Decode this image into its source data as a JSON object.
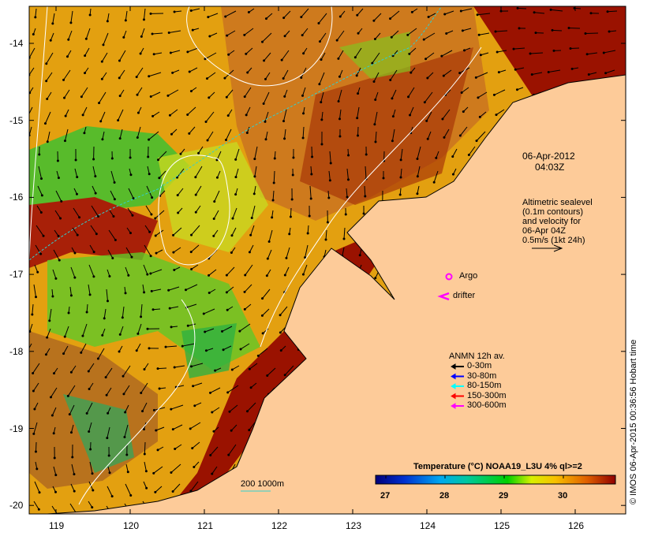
{
  "map": {
    "lon_ticks": [
      "119",
      "120",
      "121",
      "122",
      "123",
      "124",
      "125",
      "126"
    ],
    "lat_ticks": [
      "-14",
      "-15",
      "-16",
      "-17",
      "-18",
      "-19",
      "-20"
    ],
    "lon_range": [
      118.65,
      126.7
    ],
    "lat_range": [
      -13.53,
      -20.1
    ]
  },
  "annotations": {
    "date": "06-Apr-2012",
    "time": "04:03Z",
    "altimetry": [
      "Altimetric sealevel",
      "(0.1m contours)",
      "and velocity for",
      "06-Apr 04Z",
      "0.5m/s (1kt 24h)"
    ],
    "argo": "Argo",
    "drifter": "drifter",
    "scale": "200  1000m"
  },
  "legend": {
    "title": "ANMN 12h av.",
    "items": [
      {
        "label": "0-30m",
        "color": "#000000"
      },
      {
        "label": "30-80m",
        "color": "#0000ff"
      },
      {
        "label": "80-150m",
        "color": "#00ffff"
      },
      {
        "label": "150-300m",
        "color": "#ff0000"
      },
      {
        "label": "300-600m",
        "color": "#ff00ff"
      }
    ]
  },
  "colorbar": {
    "title": "Temperature (°C) NOAA19_L3U 4% ql>=2",
    "ticks": [
      "27",
      "28",
      "29",
      "30"
    ],
    "range": [
      26.8,
      30.9
    ]
  },
  "credit": "© IMOS 06-Apr-2015 00:36:56 Hobart time",
  "colors": {
    "land": "#fdcb99",
    "warm": "#e8a000",
    "hot": "#a01000",
    "green": "#22cc22"
  }
}
